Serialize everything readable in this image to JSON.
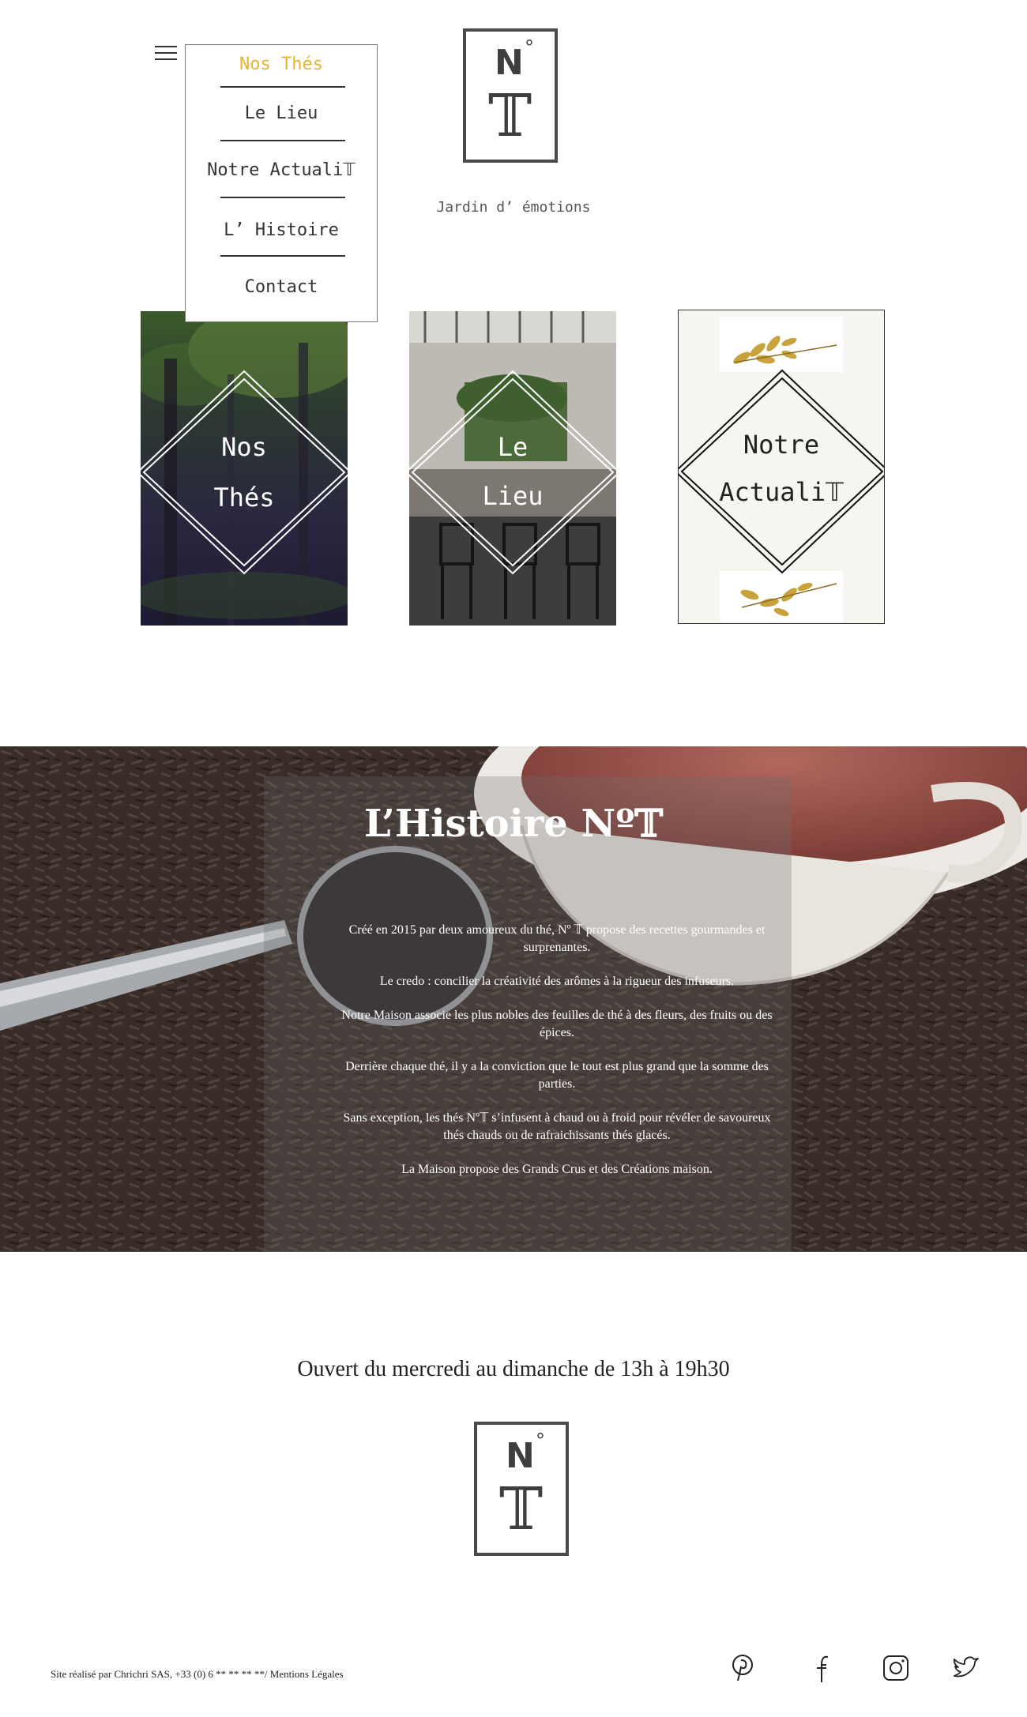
{
  "nav": {
    "items": [
      {
        "label": "Nos Thés",
        "active": true
      },
      {
        "label": "Le Lieu",
        "active": false
      },
      {
        "label": "Notre Actuali𝕋",
        "active": false
      },
      {
        "label": "L’ Histoire",
        "active": false
      },
      {
        "label": "Contact",
        "active": false
      }
    ]
  },
  "brand": {
    "logo_n": "N",
    "logo_deg": "°",
    "logo_t": "𝕋",
    "tagline": "Jardin d’ émotions"
  },
  "cards": [
    {
      "label_lines": [
        "Nos",
        "Thés"
      ]
    },
    {
      "label_lines": [
        "Le",
        "Lieu"
      ]
    },
    {
      "label_lines": [
        "Notre",
        "Actuali𝕋"
      ]
    }
  ],
  "histoire": {
    "title": "L’Histoire Nº𝕋",
    "paragraphs": [
      "Créé en 2015 par deux amoureux du thé, Nº 𝕋 propose des recettes gourmandes et surprenantes.",
      "Le credo : concilier la créativité des arômes à la rigueur des infuseurs.",
      "Notre Maison associe les plus nobles des feuilles de thé à des fleurs, des fruits ou des épices.",
      "Derrière chaque thé, il y a la conviction que le tout est plus grand que la somme des parties.",
      "Sans exception, les thés Nº𝕋 s’infusent à chaud ou à froid pour révéler de savoureux thés chauds ou de rafraichissants thés glacés.",
      "La Maison propose des Grands Crus et des Créations maison."
    ]
  },
  "hours": "Ouvert du mercredi au dimanche de 13h à 19h30",
  "footer": {
    "credit": "Site réalisé par Chrichri SAS, +33 (0) 6 ** ** ** **/ ",
    "legal_link": "Mentions Légales",
    "social": [
      "pinterest-icon",
      "facebook-icon",
      "instagram-icon",
      "twitter-icon"
    ]
  },
  "colors": {
    "accent": "#e7b431",
    "logo": "#4a4a4a"
  }
}
